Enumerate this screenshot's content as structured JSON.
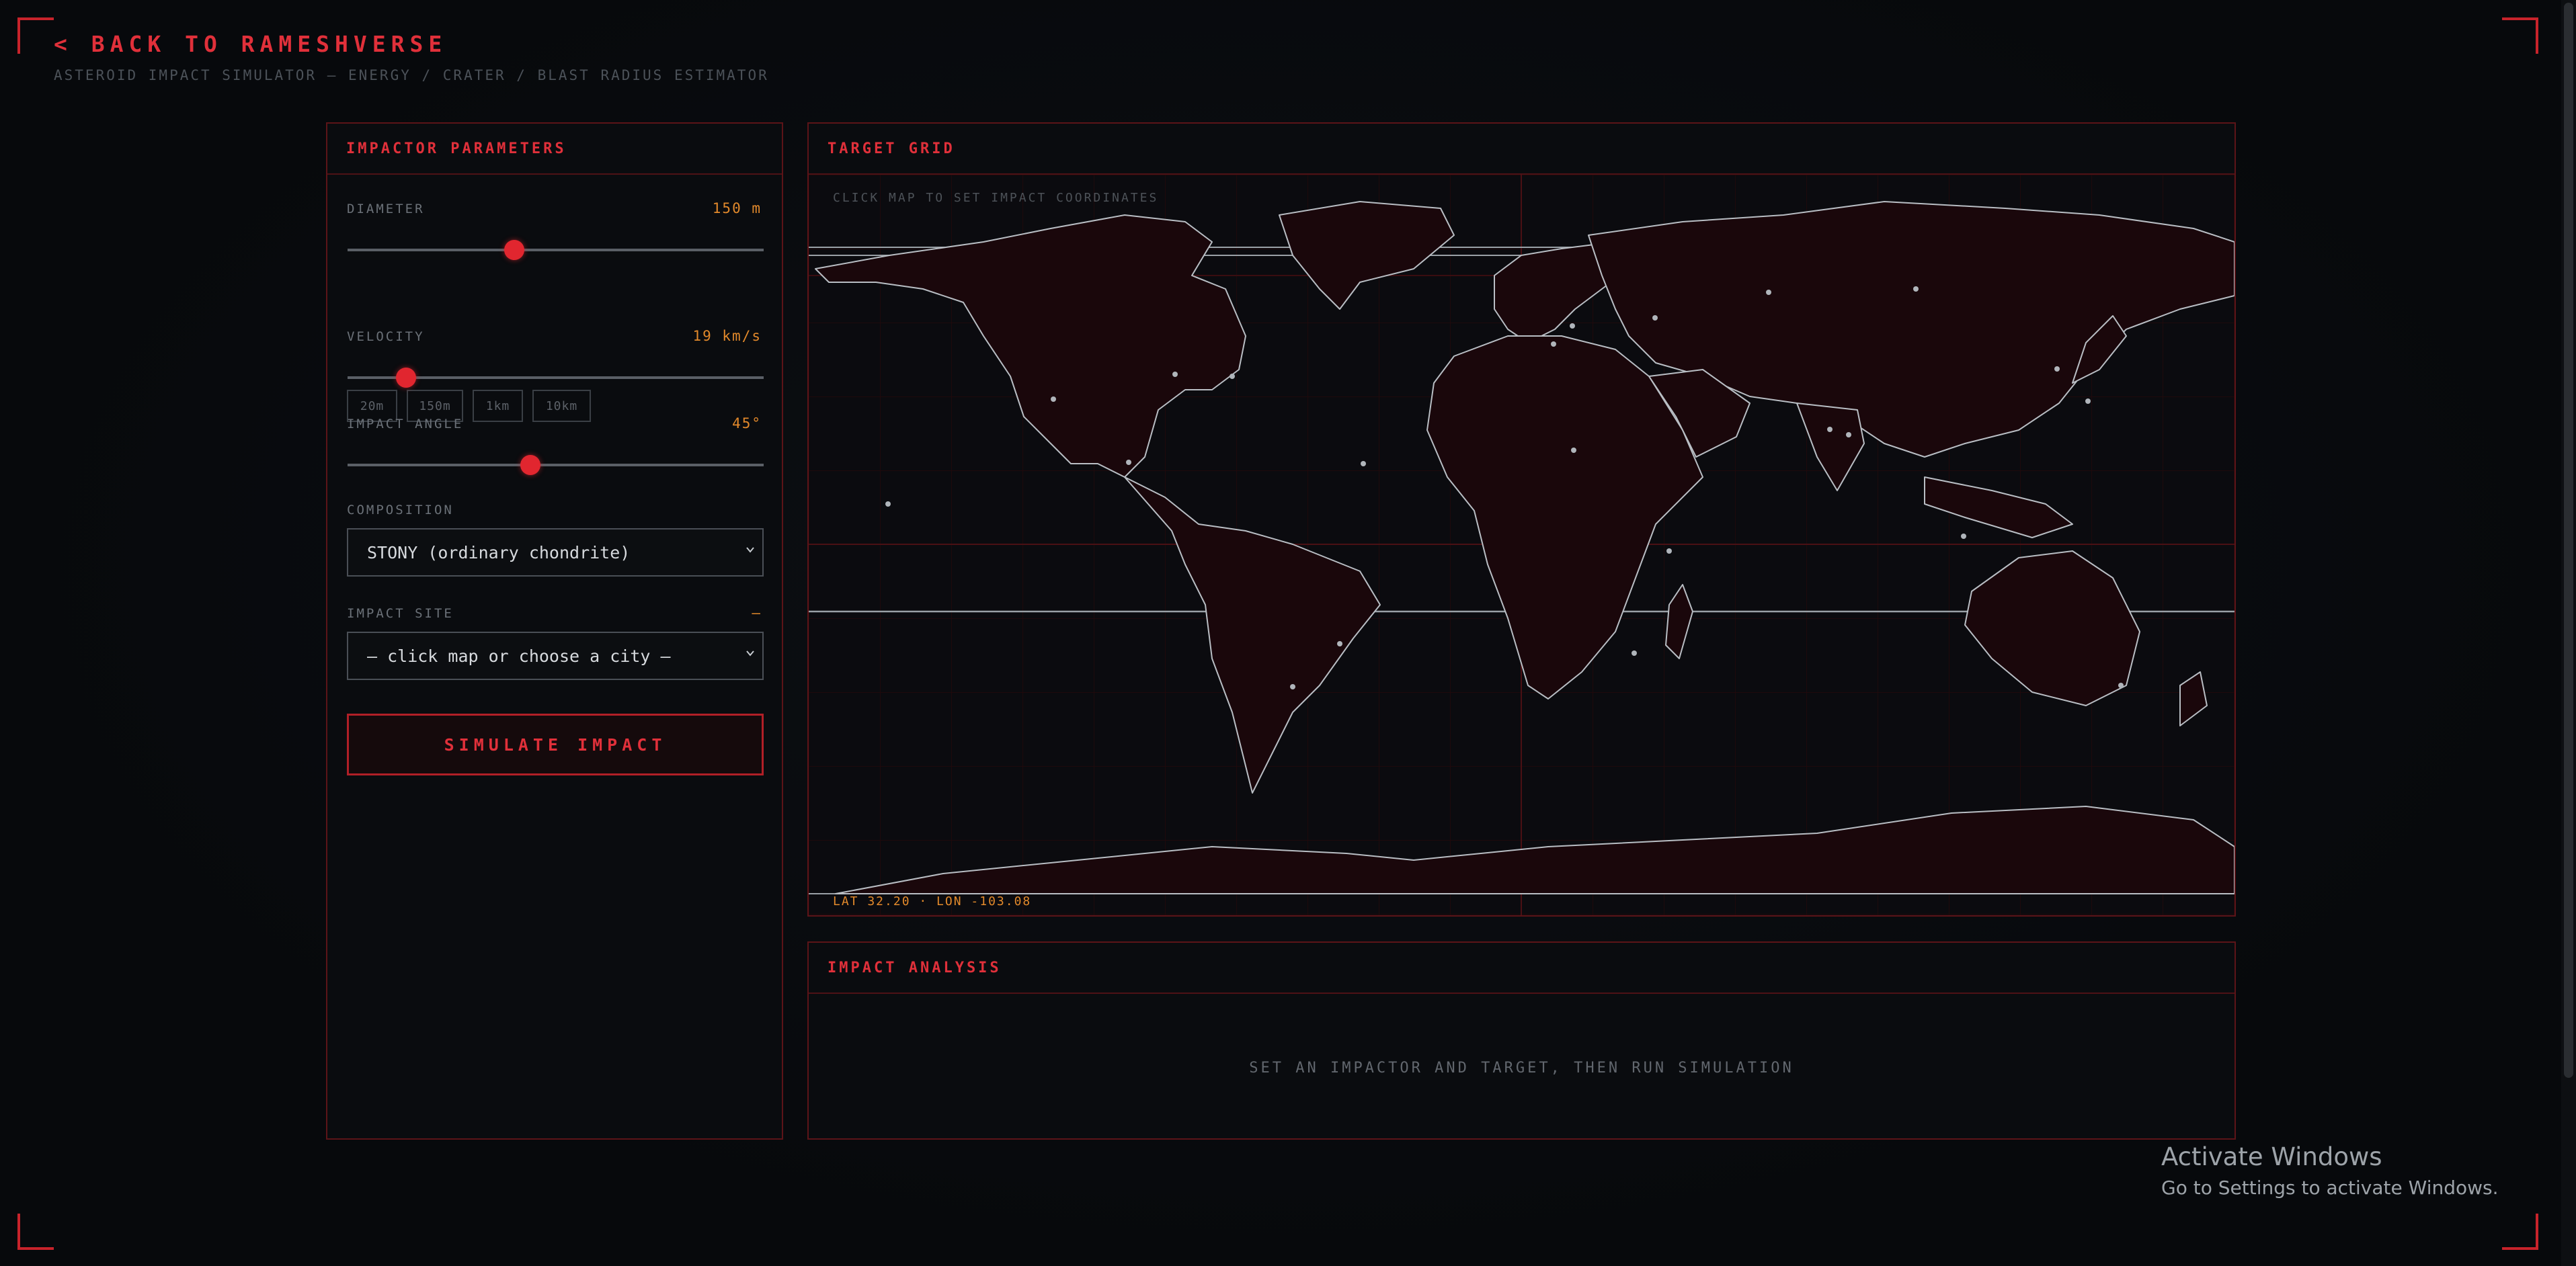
{
  "header": {
    "back_label": "< BACK TO RAMESHVERSE",
    "subtitle": "ASTEROID IMPACT SIMULATOR — ENERGY / CRATER / BLAST RADIUS ESTIMATOR"
  },
  "impactor": {
    "title": "IMPACTOR PARAMETERS",
    "diameter": {
      "label": "DIAMETER",
      "value": "150 m",
      "slider_fraction": 0.4
    },
    "presets": [
      "20m",
      "150m",
      "1km",
      "10km"
    ],
    "velocity": {
      "label": "VELOCITY",
      "value": "19 km/s",
      "slider_fraction": 0.14
    },
    "angle": {
      "label": "IMPACT ANGLE",
      "value": "45°",
      "slider_fraction": 0.44
    },
    "composition": {
      "label": "COMPOSITION",
      "selected": "STONY (ordinary chondrite)"
    },
    "site": {
      "label": "IMPACT SITE",
      "value": "—",
      "selected": "— click map or choose a city —"
    },
    "simulate_label": "SIMULATE IMPACT"
  },
  "map": {
    "title": "TARGET GRID",
    "hint": "CLICK MAP TO SET IMPACT COORDINATES",
    "coords": "LAT 32.20 · LON -103.08"
  },
  "analysis": {
    "title": "IMPACT ANALYSIS",
    "message": "SET AN IMPACTOR AND TARGET, THEN RUN SIMULATION"
  },
  "watermark": {
    "title": "Activate Windows",
    "subtitle": "Go to Settings to activate Windows."
  },
  "colors": {
    "accent": "#e0303a",
    "value": "#e2892b",
    "border": "#5c1418",
    "background": "#07090c"
  }
}
